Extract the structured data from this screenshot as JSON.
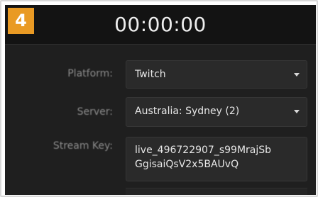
{
  "step_badge": "4",
  "timer": "00:00:00",
  "form": {
    "platform": {
      "label": "Platform:",
      "value": "Twitch"
    },
    "server": {
      "label": "Server:",
      "value": "Australia: Sydney (2)"
    },
    "stream_key": {
      "label": "Stream Key:",
      "value": "live_496722907_s99MrajSb\nGgisaiQsV2x5BAUvQ"
    }
  },
  "colors": {
    "badge": "#e99a24",
    "panel": "#1f1f1f",
    "timer_bar": "#131313",
    "field": "#2a2a2a"
  },
  "icons": {
    "dropdown": "chevron-down-icon"
  }
}
